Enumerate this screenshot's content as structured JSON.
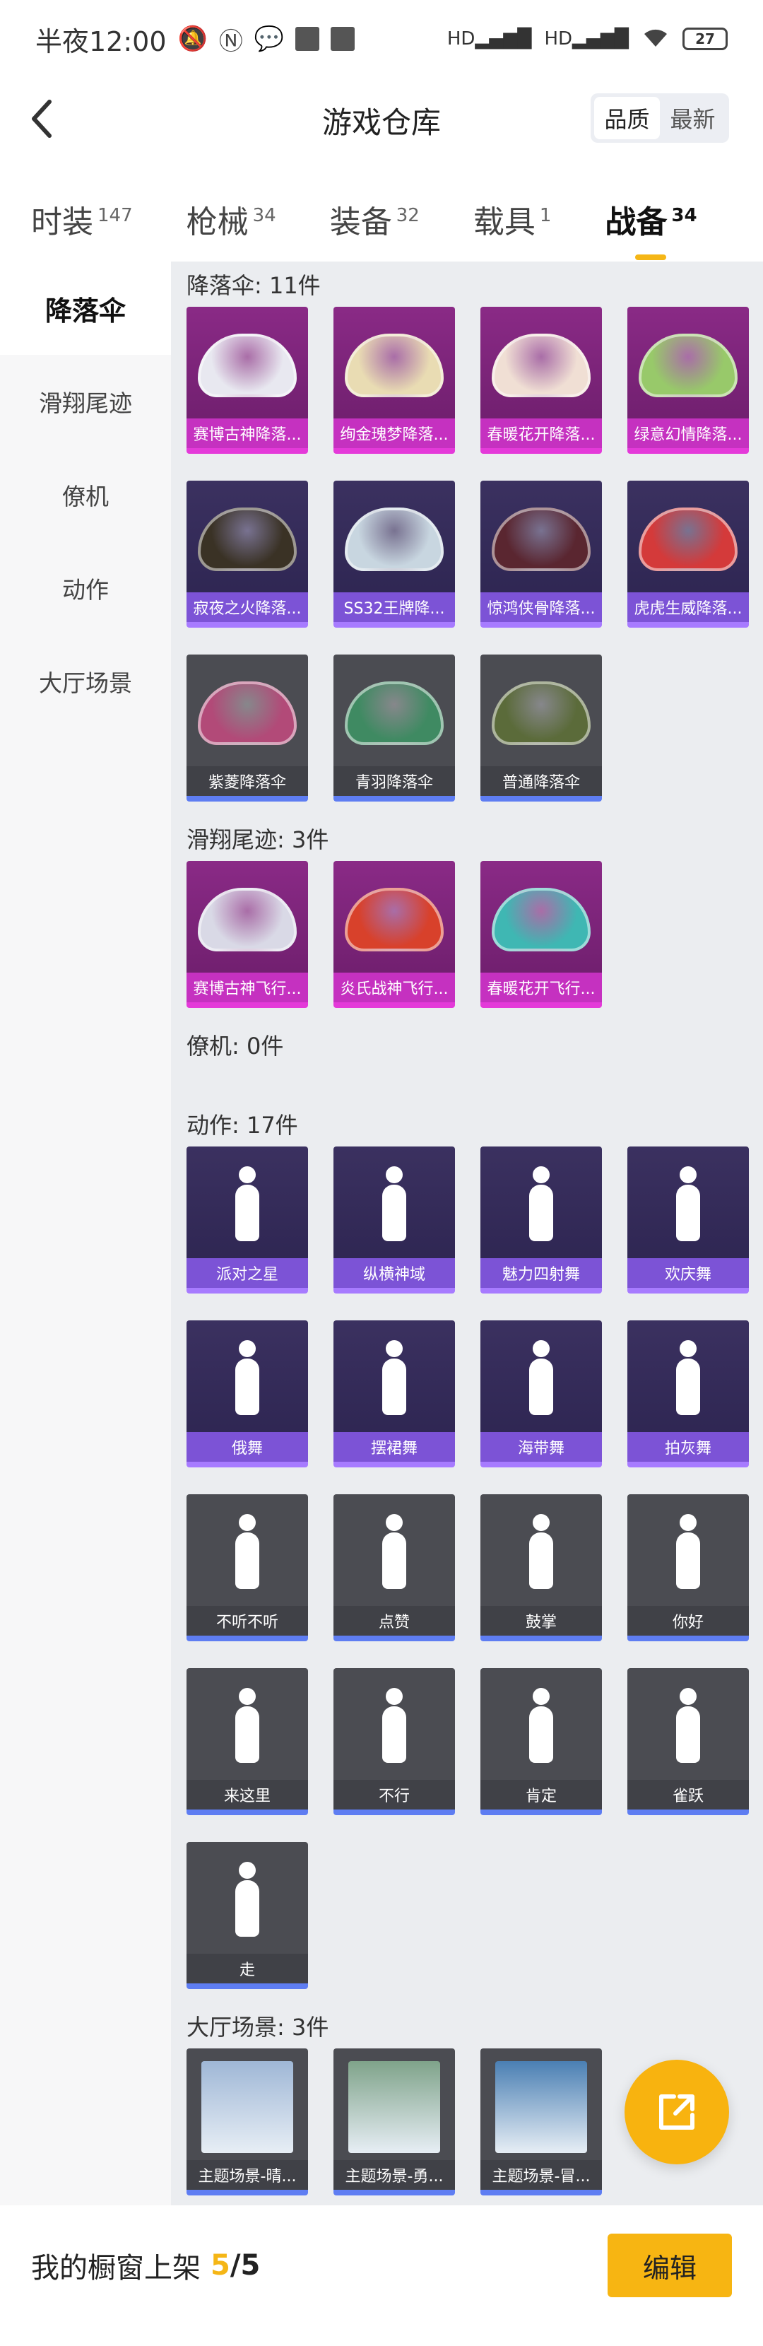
{
  "status_bar": {
    "time": "半夜12:00",
    "battery": "27",
    "net1": "HD",
    "net2": "HD"
  },
  "header": {
    "title": "游戏仓库",
    "sort_quality": "品质",
    "sort_latest": "最新"
  },
  "tabs": [
    {
      "label": "时装",
      "count": "147"
    },
    {
      "label": "枪械",
      "count": "34"
    },
    {
      "label": "装备",
      "count": "32"
    },
    {
      "label": "载具",
      "count": "1"
    },
    {
      "label": "战备",
      "count": "34"
    }
  ],
  "sidebar": [
    "降落伞",
    "滑翔尾迹",
    "僚机",
    "动作",
    "大厅场景"
  ],
  "sections": [
    {
      "title": "降落伞: 11件",
      "items": [
        {
          "label": "赛博古神降落...",
          "rarity": "pink",
          "color": "#e8e8f0"
        },
        {
          "label": "绚金瑰梦降落...",
          "rarity": "pink",
          "color": "#e9dcb3"
        },
        {
          "label": "春暖花开降落...",
          "rarity": "pink",
          "color": "#f0dfd4"
        },
        {
          "label": "绿意幻情降落...",
          "rarity": "pink",
          "color": "#98c96a"
        },
        {
          "label": "寂夜之火降落...",
          "rarity": "purple",
          "color": "#3a3225"
        },
        {
          "label": "SS32王牌降...",
          "rarity": "purple",
          "color": "#c8d6e0"
        },
        {
          "label": "惊鸿侠骨降落...",
          "rarity": "purple",
          "color": "#5a2630"
        },
        {
          "label": "虎虎生威降落...",
          "rarity": "purple",
          "color": "#d43a3a"
        },
        {
          "label": "紫菱降落伞",
          "rarity": "grey",
          "color": "#b24a78"
        },
        {
          "label": "青羽降落伞",
          "rarity": "grey",
          "color": "#3f8a62"
        },
        {
          "label": "普通降落伞",
          "rarity": "grey",
          "color": "#5b6b3a"
        }
      ]
    },
    {
      "title": "滑翔尾迹: 3件",
      "items": [
        {
          "label": "赛博古神飞行...",
          "rarity": "pink",
          "color": "#d9d9e6"
        },
        {
          "label": "炎氏战神飞行...",
          "rarity": "pink",
          "color": "#d8412b"
        },
        {
          "label": "春暖花开飞行...",
          "rarity": "pink",
          "color": "#3fb7b3"
        }
      ]
    },
    {
      "title": "僚机: 0件",
      "items": []
    },
    {
      "title": "动作: 17件",
      "items": [
        {
          "label": "派对之星",
          "rarity": "purple"
        },
        {
          "label": "纵横神域",
          "rarity": "purple"
        },
        {
          "label": "魅力四射舞",
          "rarity": "purple"
        },
        {
          "label": "欢庆舞",
          "rarity": "purple"
        },
        {
          "label": "俄舞",
          "rarity": "purple"
        },
        {
          "label": "摆裙舞",
          "rarity": "purple"
        },
        {
          "label": "海带舞",
          "rarity": "purple"
        },
        {
          "label": "拍灰舞",
          "rarity": "purple"
        },
        {
          "label": "不听不听",
          "rarity": "grey"
        },
        {
          "label": "点赞",
          "rarity": "grey"
        },
        {
          "label": "鼓掌",
          "rarity": "grey"
        },
        {
          "label": "你好",
          "rarity": "grey"
        },
        {
          "label": "来这里",
          "rarity": "grey"
        },
        {
          "label": "不行",
          "rarity": "grey"
        },
        {
          "label": "肯定",
          "rarity": "grey"
        },
        {
          "label": "雀跃",
          "rarity": "grey"
        },
        {
          "label": "走",
          "rarity": "grey"
        }
      ]
    },
    {
      "title": "大厅场景: 3件",
      "items": [
        {
          "label": "主题场景-晴...",
          "rarity": "grey",
          "color": "#9fb7d6"
        },
        {
          "label": "主题场景-勇...",
          "rarity": "grey",
          "color": "#7fa38a"
        },
        {
          "label": "主题场景-冒...",
          "rarity": "grey",
          "color": "#4a7fb3"
        }
      ]
    }
  ],
  "bottom": {
    "showcase_label": "我的橱窗上架",
    "showcase_current": "5",
    "showcase_total": "/5",
    "edit_label": "编辑"
  },
  "colors": {
    "accent": "#f5b616",
    "pink": "#c531c0",
    "purple": "#7c53d6",
    "grey": "#404147"
  }
}
